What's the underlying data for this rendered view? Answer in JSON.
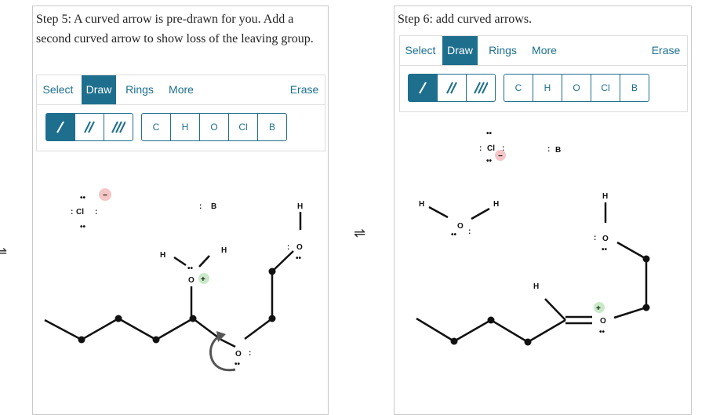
{
  "step5": {
    "instruction": "Step 5: A curved arrow is pre-drawn for you. Add a second curved arrow to show loss of the leaving group.",
    "tabs": {
      "select": "Select",
      "draw": "Draw",
      "rings": "Rings",
      "more": "More",
      "erase": "Erase"
    },
    "atoms": [
      "C",
      "H",
      "O",
      "Cl",
      "B"
    ],
    "labels": {
      "cl": "Cl",
      "b": "B",
      "h1": "H",
      "h2": "H",
      "h3": "H",
      "o_top": "O",
      "o_mid": "O",
      "o_low": "O"
    }
  },
  "step6": {
    "instruction": "Step 6: add curved arrows.",
    "tabs": {
      "select": "Select",
      "draw": "Draw",
      "rings": "Rings",
      "more": "More",
      "erase": "Erase"
    },
    "atoms": [
      "C",
      "H",
      "O",
      "Cl",
      "B"
    ],
    "labels": {
      "cl": "Cl",
      "b": "B",
      "h1": "H",
      "h2": "H",
      "o_water": "O",
      "h3": "H",
      "o_top": "O",
      "h4": "H",
      "o_plus": "O"
    }
  },
  "equilibrium_symbol": "⇌",
  "colors": {
    "accent": "#1e6f8e",
    "plus_charge": "#c8eac8",
    "minus_charge": "#f5c6c6"
  },
  "bond_tools": [
    "single-bond-icon",
    "double-bond-icon",
    "triple-bond-icon"
  ]
}
